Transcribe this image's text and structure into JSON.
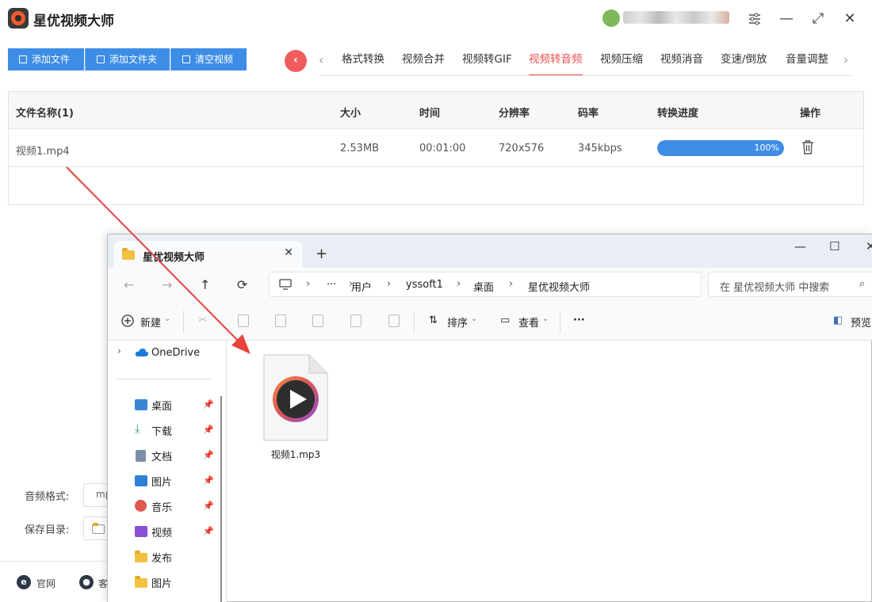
{
  "app": {
    "title": "星优视频大师",
    "toolbar": [
      "添加文件",
      "添加文件夹",
      "清空视频"
    ],
    "tabs": [
      "格式转换",
      "视频合并",
      "视频转GIF",
      "视频转音频",
      "视频压缩",
      "视频消音",
      "变速/倒放",
      "音量调整"
    ],
    "active_tab": "视频转音频",
    "table": {
      "headers": [
        "文件名称(1)",
        "大小",
        "时间",
        "分辨率",
        "码率",
        "转换进度",
        "操作"
      ],
      "rows": [
        {
          "name": "视频1.mp4",
          "size": "2.53MB",
          "time": "00:01:00",
          "resolution": "720x576",
          "bitrate": "345kbps",
          "progress_label": "100%",
          "progress": 1.0
        }
      ]
    },
    "bottom": {
      "audio_format_label": "音频格式:",
      "audio_format_value": "mp",
      "save_dir_label": "保存目录:",
      "links": [
        "官网",
        "客"
      ]
    },
    "colors": {
      "accent": "#3d8de6",
      "active_tab": "#e9514f",
      "back_button": "#f05c5c"
    },
    "icons": {
      "logo": "camera-icon",
      "settings": "sliders-icon",
      "back": "chevron-left-icon",
      "delete": "trash-icon"
    }
  },
  "explorer": {
    "tab_title": "星优视频大师",
    "breadcrumb": [
      "用户",
      "yssoft1",
      "桌面",
      "星优视频大师"
    ],
    "search_placeholder": "在 星优视频大师 中搜索",
    "commands": {
      "new": "新建",
      "sort": "排序",
      "view": "查看",
      "more": "···",
      "preview": "预览"
    },
    "sidebar": {
      "onedrive": "OneDrive",
      "items": [
        {
          "label": "桌面",
          "pinned": true
        },
        {
          "label": "下载",
          "pinned": true
        },
        {
          "label": "文档",
          "pinned": true
        },
        {
          "label": "图片",
          "pinned": true
        },
        {
          "label": "音乐",
          "pinned": true
        },
        {
          "label": "视频",
          "pinned": true
        },
        {
          "label": "发布",
          "pinned": false
        },
        {
          "label": "图片",
          "pinned": false
        }
      ]
    },
    "files": [
      {
        "name": "视频1.mp3",
        "icon": "media-file-icon"
      }
    ]
  }
}
